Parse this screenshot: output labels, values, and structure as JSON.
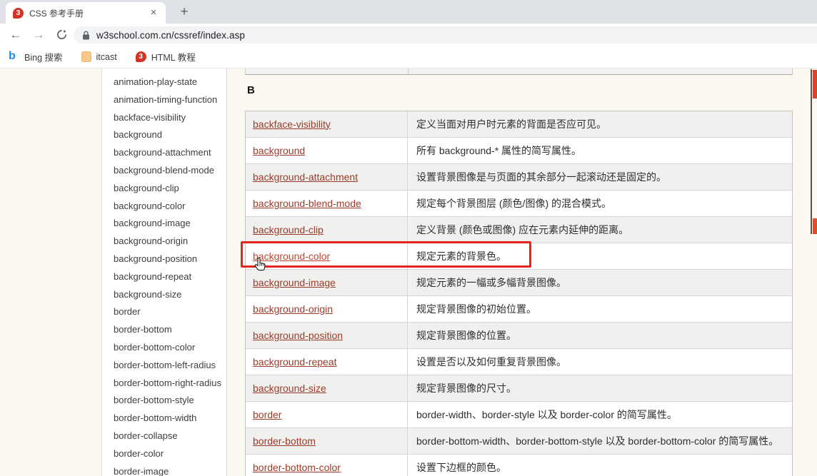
{
  "browser": {
    "tab": {
      "title": "CSS 参考手册",
      "close": "×",
      "new_tab": "+"
    },
    "nav": {
      "back": "←",
      "forward": "→"
    },
    "address": {
      "url": "w3school.com.cn/cssref/index.asp"
    },
    "bookmarks": [
      {
        "label": "Bing 搜索",
        "icon": "bing-icon"
      },
      {
        "label": "itcast",
        "icon": "itcast-icon"
      },
      {
        "label": "HTML 教程",
        "icon": "w3school-icon"
      }
    ]
  },
  "sidebar": {
    "items": [
      "animation-play-state",
      "animation-timing-function",
      "backface-visibility",
      "background",
      "background-attachment",
      "background-blend-mode",
      "background-clip",
      "background-color",
      "background-image",
      "background-origin",
      "background-position",
      "background-repeat",
      "background-size",
      "border",
      "border-bottom",
      "border-bottom-color",
      "border-bottom-left-radius",
      "border-bottom-right-radius",
      "border-bottom-style",
      "border-bottom-width",
      "border-collapse",
      "border-color",
      "border-image"
    ]
  },
  "content": {
    "heading": "B",
    "rows": [
      {
        "property": "backface-visibility",
        "description": "定义当面对用户时元素的背面是否应可见。"
      },
      {
        "property": "background",
        "description": "所有 background-* 属性的简写属性。"
      },
      {
        "property": "background-attachment",
        "description": "设置背景图像是与页面的其余部分一起滚动还是固定的。"
      },
      {
        "property": "background-blend-mode",
        "description": "规定每个背景图层 (颜色/图像) 的混合模式。"
      },
      {
        "property": "background-clip",
        "description": "定义背景 (颜色或图像) 应在元素内延伸的距离。"
      },
      {
        "property": "background-color",
        "description": "规定元素的背景色。",
        "highlighted": true
      },
      {
        "property": "background-image",
        "description": "规定元素的一幅或多幅背景图像。"
      },
      {
        "property": "background-origin",
        "description": "规定背景图像的初始位置。"
      },
      {
        "property": "background-position",
        "description": "规定背景图像的位置。"
      },
      {
        "property": "background-repeat",
        "description": "设置是否以及如何重复背景图像。"
      },
      {
        "property": "background-size",
        "description": "规定背景图像的尺寸。"
      },
      {
        "property": "border",
        "description": "border-width、border-style 以及 border-color 的简写属性。"
      },
      {
        "property": "border-bottom",
        "description": "border-bottom-width、border-bottom-style 以及 border-bottom-color 的简写属性。"
      },
      {
        "property": "border-bottom-color",
        "description": "设置下边框的颜色。"
      }
    ]
  },
  "colors": {
    "annotation_red": "#e3261d",
    "link": "#9c3a28",
    "link_hover": "#c2452e"
  }
}
